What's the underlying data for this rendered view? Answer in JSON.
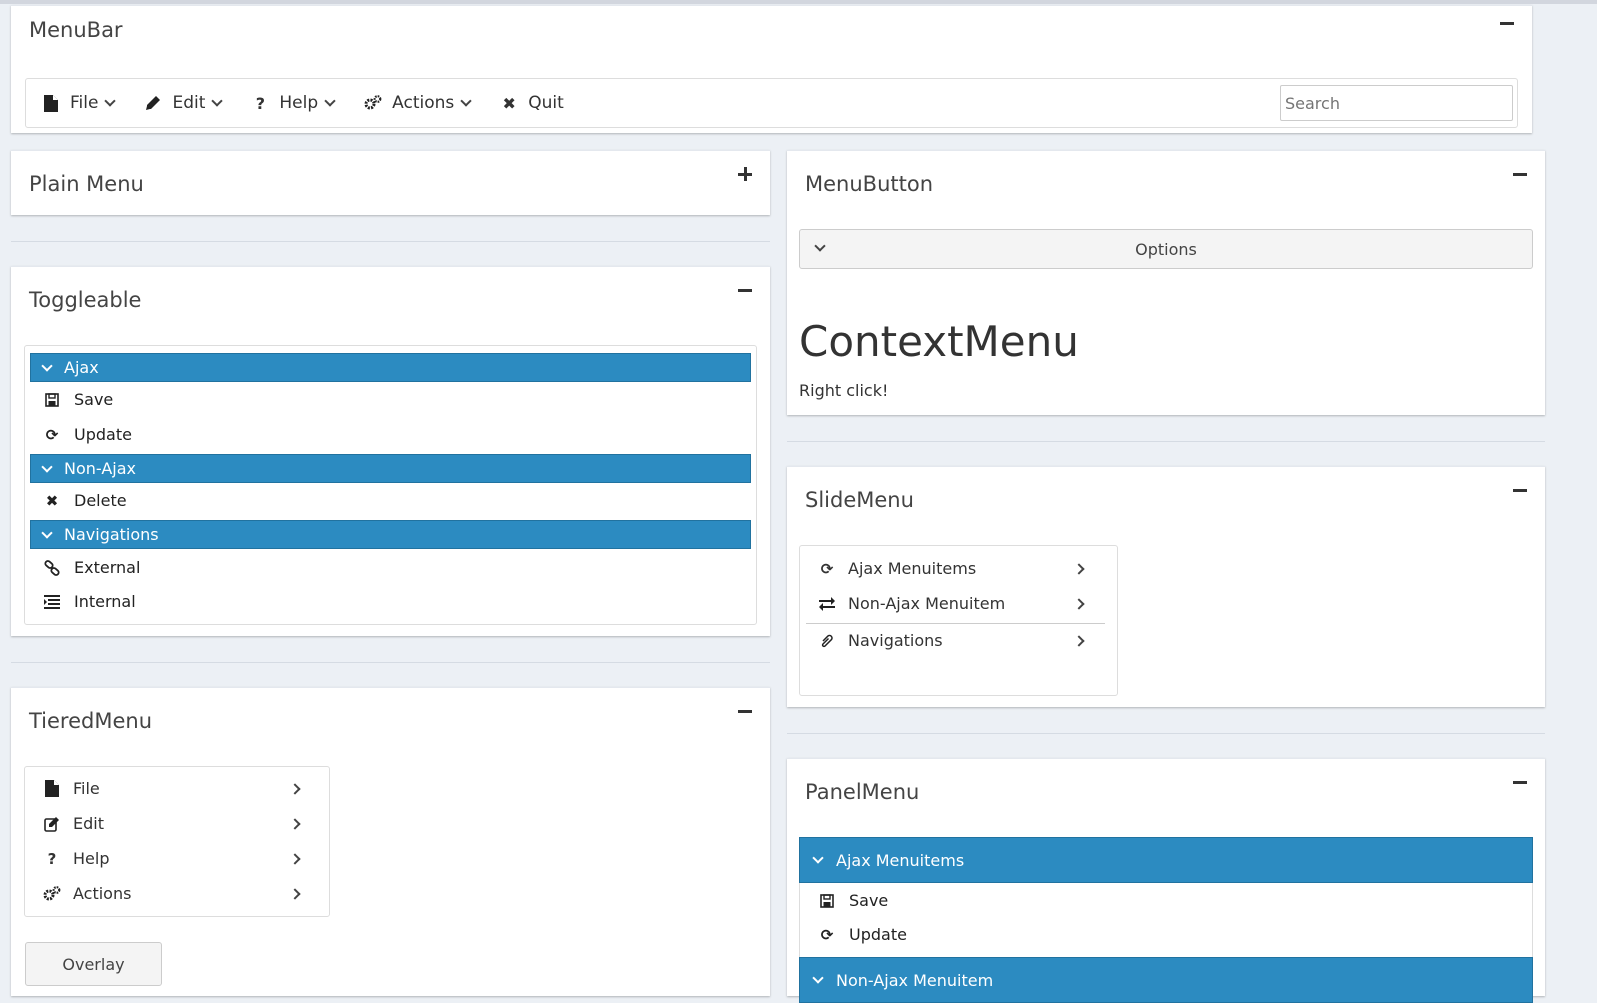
{
  "menubar": {
    "title": "MenuBar",
    "items": [
      {
        "label": "File",
        "icon": "file-icon"
      },
      {
        "label": "Edit",
        "icon": "pencil-icon"
      },
      {
        "label": "Help",
        "icon": "question-icon"
      },
      {
        "label": "Actions",
        "icon": "gears-icon"
      },
      {
        "label": "Quit",
        "icon": "close-icon"
      }
    ],
    "search_placeholder": "Search"
  },
  "plain_menu": {
    "title": "Plain Menu"
  },
  "toggleable": {
    "title": "Toggleable",
    "groups": [
      {
        "label": "Ajax",
        "items": [
          {
            "label": "Save",
            "icon": "save-icon"
          },
          {
            "label": "Update",
            "icon": "refresh-icon"
          }
        ]
      },
      {
        "label": "Non-Ajax",
        "items": [
          {
            "label": "Delete",
            "icon": "close-icon"
          }
        ]
      },
      {
        "label": "Navigations",
        "items": [
          {
            "label": "External",
            "icon": "link-icon"
          },
          {
            "label": "Internal",
            "icon": "list-icon"
          }
        ]
      }
    ]
  },
  "tiered_menu": {
    "title": "TieredMenu",
    "items": [
      {
        "label": "File",
        "icon": "file-icon"
      },
      {
        "label": "Edit",
        "icon": "edit-icon"
      },
      {
        "label": "Help",
        "icon": "question-icon"
      },
      {
        "label": "Actions",
        "icon": "gears-icon"
      }
    ],
    "overlay_label": "Overlay"
  },
  "menu_button": {
    "title": "MenuButton",
    "options_label": "Options",
    "context_title": "ContextMenu",
    "context_hint": "Right click!"
  },
  "slide_menu": {
    "title": "SlideMenu",
    "items": [
      {
        "label": "Ajax Menuitems",
        "icon": "refresh-icon"
      },
      {
        "label": "Non-Ajax Menuitem",
        "icon": "exchange-icon"
      },
      {
        "label": "Navigations",
        "icon": "paperclip-icon"
      }
    ]
  },
  "panel_menu": {
    "title": "PanelMenu",
    "groups": [
      {
        "label": "Ajax Menuitems",
        "items": [
          {
            "label": "Save",
            "icon": "save-icon"
          },
          {
            "label": "Update",
            "icon": "refresh-icon"
          }
        ]
      },
      {
        "label": "Non-Ajax Menuitem"
      }
    ]
  },
  "colors": {
    "accent": "#2c8bc1",
    "background": "#ecf0f5"
  }
}
